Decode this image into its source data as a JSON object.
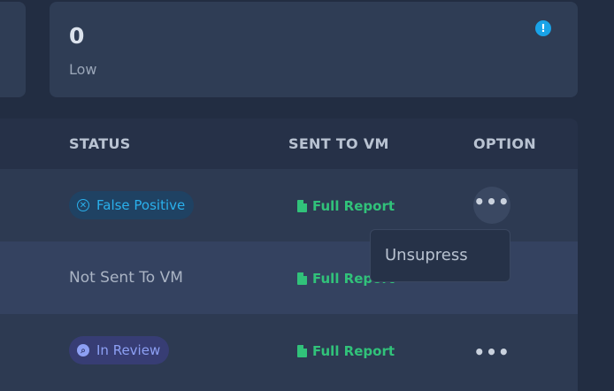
{
  "summary_card": {
    "value": "0",
    "label": "Low",
    "info_icon": "!"
  },
  "table": {
    "headers": [
      "STATUS",
      "SENT TO VM",
      "OPTION"
    ],
    "rows": [
      {
        "status": "False Positive",
        "status_type": "badge-false-positive",
        "report": "Full Report",
        "option": "•••"
      },
      {
        "status": "Not Sent To VM",
        "status_type": "plain",
        "report": "Full Report",
        "option": ""
      },
      {
        "status": "In Review",
        "status_type": "badge-in-review",
        "report": "Full Report",
        "option": "•••"
      }
    ]
  },
  "dropdown": {
    "items": [
      "Unsupress"
    ]
  },
  "colors": {
    "background": "#222d42",
    "card": "#2f3d55",
    "report_green": "#31c27a",
    "false_positive_blue": "#2ab0ec",
    "in_review_purple": "#8da0f4",
    "info_blue": "#19a3e8"
  },
  "icons": {
    "false_positive": "x-circle-icon",
    "in_review": "search-icon",
    "report": "file-report-icon",
    "info": "info-icon"
  }
}
